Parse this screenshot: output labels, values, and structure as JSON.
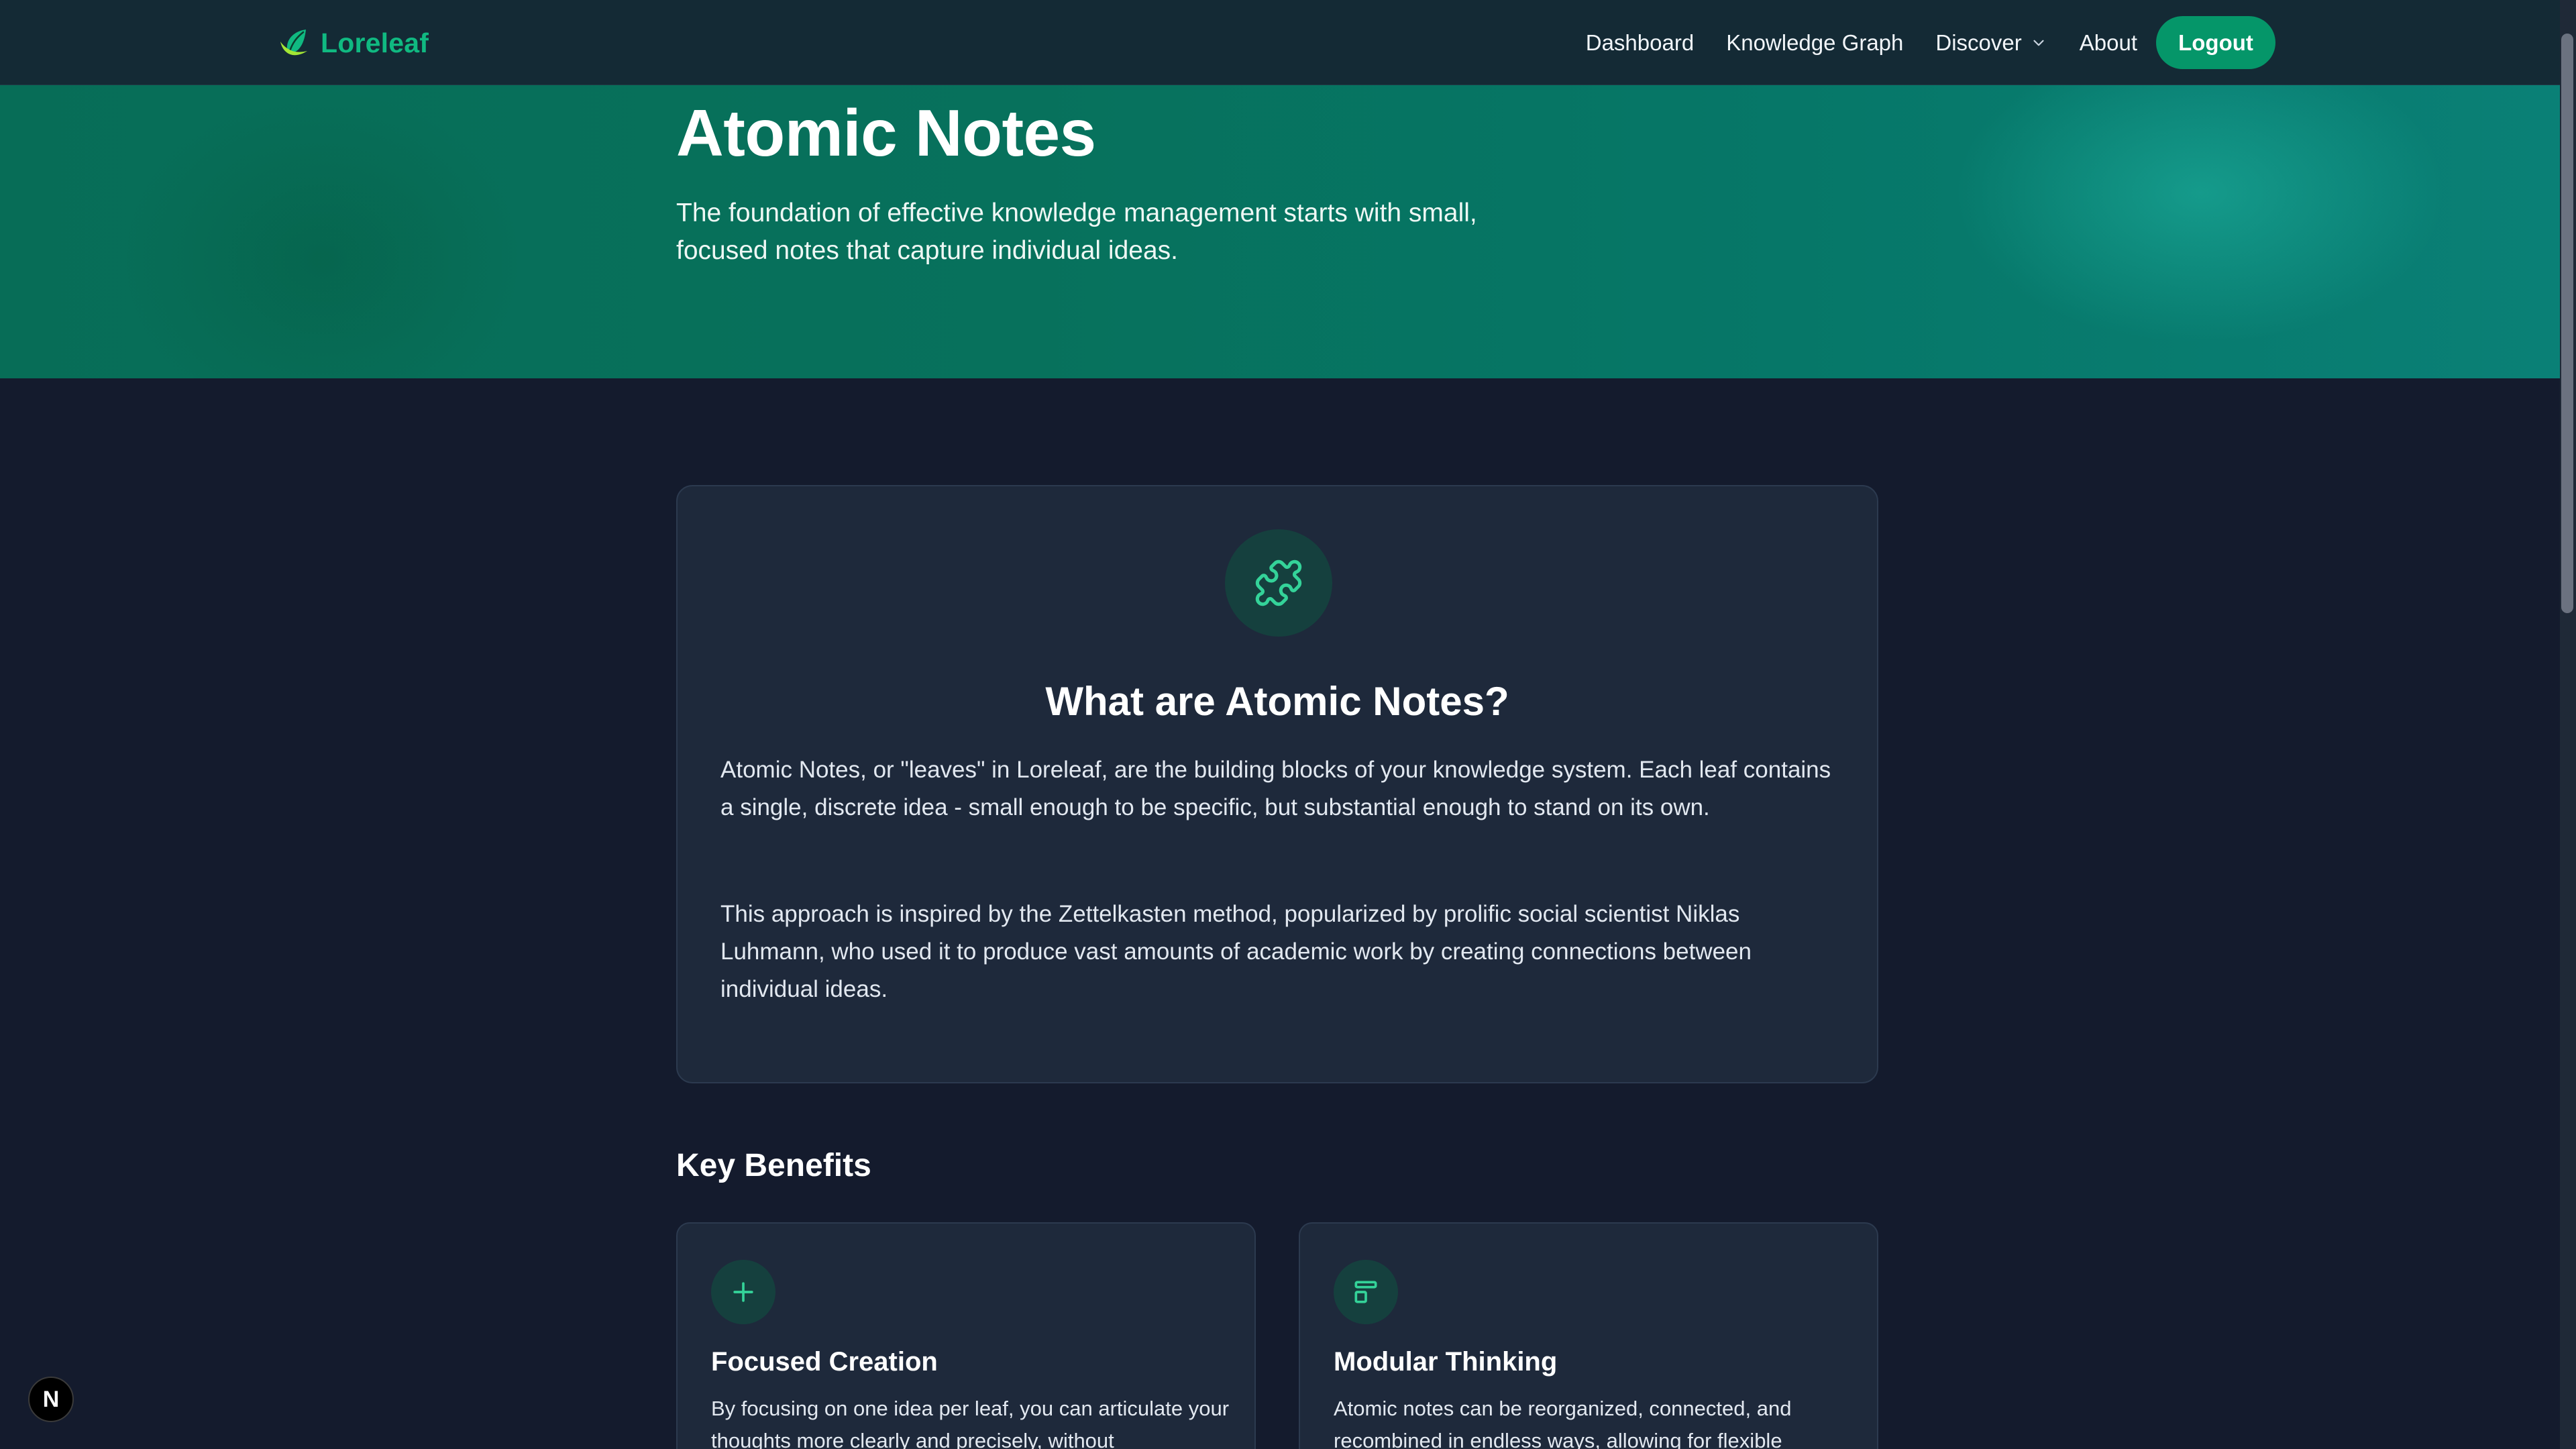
{
  "brand": {
    "name": "Loreleaf",
    "logo_icon": "leaf-icon",
    "color": "#10b981"
  },
  "nav": {
    "links": [
      "Dashboard",
      "Knowledge Graph",
      "Discover",
      "About"
    ],
    "discover_icon": "chevron-down-icon",
    "logout_label": "Logout"
  },
  "hero": {
    "title": "Atomic Notes",
    "subtitle": "The foundation of effective knowledge management starts with small, focused notes that capture individual ideas."
  },
  "info": {
    "icon": "puzzle-icon",
    "title": "What are Atomic Notes?",
    "paragraphs": [
      "Atomic Notes, or \"leaves\" in Loreleaf, are the building blocks of your knowledge system. Each leaf contains a single, discrete idea - small enough to be specific, but substantial enough to stand on its own.",
      "This approach is inspired by the Zettelkasten method, popularized by prolific social scientist Niklas Luhmann, who used it to produce vast amounts of academic work by creating connections between individual ideas."
    ]
  },
  "benefits": {
    "title": "Key Benefits",
    "items": [
      {
        "icon": "plus-icon",
        "title": "Focused Creation",
        "text": "By focusing on one idea per leaf, you can articulate your thoughts more clearly and precisely, without"
      },
      {
        "icon": "layout-icon",
        "title": "Modular Thinking",
        "text": "Atomic notes can be reorganized, connected, and recombined in endless ways, allowing for flexible"
      }
    ]
  },
  "devtools": {
    "badge_label": "N"
  },
  "colors": {
    "accent": "#10b981",
    "button": "#059669",
    "background": "#141b2d",
    "card": "#1e293b",
    "navbar": "#142a35"
  }
}
